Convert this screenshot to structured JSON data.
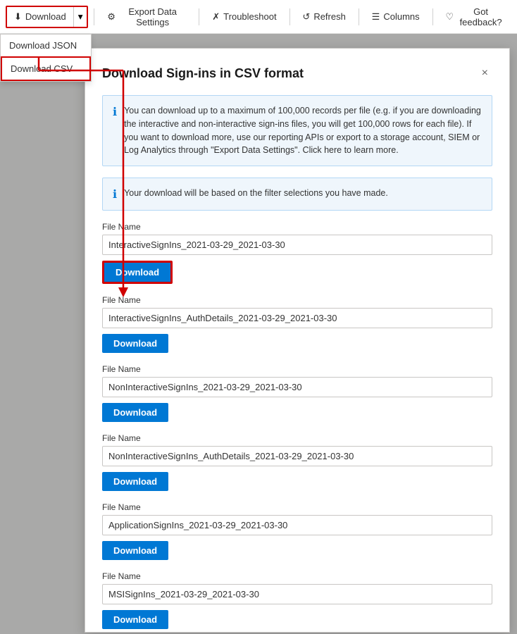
{
  "toolbar": {
    "download_label": "Download",
    "chevron": "▾",
    "export_label": "Export Data Settings",
    "troubleshoot_label": "Troubleshoot",
    "refresh_label": "Refresh",
    "columns_label": "Columns",
    "feedback_label": "Got feedback?"
  },
  "dropdown": {
    "json_label": "Download JSON",
    "csv_label": "Download CSV"
  },
  "modal": {
    "title": "Download Sign-ins in CSV format",
    "close_label": "×",
    "info1": "You can download up to a maximum of 100,000 records per file (e.g. if you are downloading the interactive and non-interactive sign-ins files, you will get 100,000 rows for each file). If you want to download more, use our reporting APIs or export to a storage account, SIEM or Log Analytics through \"Export Data Settings\". Click here to learn more.",
    "info2": "Your download will be based on the filter selections you have made.",
    "file_label": "File Name",
    "files": [
      {
        "name": "InteractiveSignIns_2021-03-29_2021-03-30",
        "highlighted": true
      },
      {
        "name": "InteractiveSignIns_AuthDetails_2021-03-29_2021-03-30",
        "highlighted": false
      },
      {
        "name": "NonInteractiveSignIns_2021-03-29_2021-03-30",
        "highlighted": false
      },
      {
        "name": "NonInteractiveSignIns_AuthDetails_2021-03-29_2021-03-30",
        "highlighted": false
      },
      {
        "name": "ApplicationSignIns_2021-03-29_2021-03-30",
        "highlighted": false
      },
      {
        "name": "MSISignIns_2021-03-29_2021-03-30",
        "highlighted": false
      }
    ],
    "download_button_label": "Download"
  },
  "colors": {
    "accent": "#0078d4",
    "red": "#d00000",
    "info_bg": "#eff6fc"
  }
}
